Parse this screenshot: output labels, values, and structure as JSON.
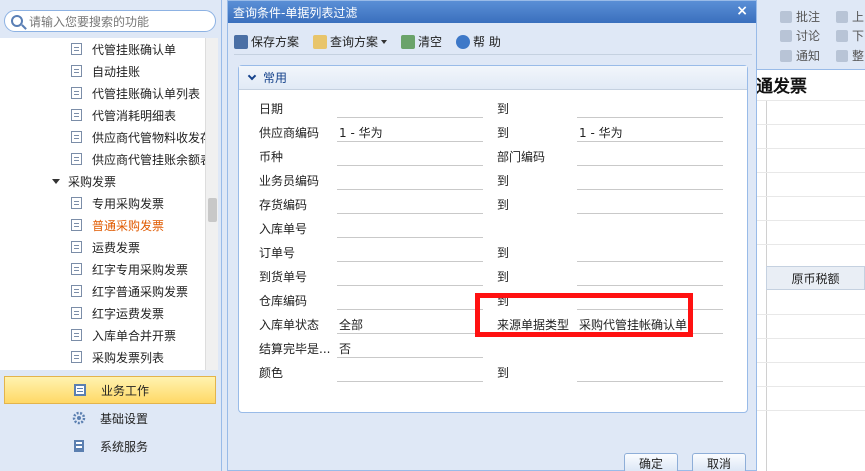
{
  "sidebar": {
    "search_placeholder": "请输入您要搜索的功能",
    "tree_items": [
      {
        "label": "代管挂账确认单",
        "indent": 2,
        "active": false
      },
      {
        "label": "自动挂账",
        "indent": 2,
        "active": false
      },
      {
        "label": "代管挂账确认单列表",
        "indent": 2,
        "active": false
      },
      {
        "label": "代管消耗明细表",
        "indent": 2,
        "active": false
      },
      {
        "label": "供应商代管物料收发存汇",
        "indent": 2,
        "active": false
      },
      {
        "label": "供应商代管挂账余额表",
        "indent": 2,
        "active": false
      },
      {
        "label": "采购发票",
        "indent": 1,
        "active": false,
        "group": true
      },
      {
        "label": "专用采购发票",
        "indent": 2,
        "active": false
      },
      {
        "label": "普通采购发票",
        "indent": 2,
        "active": true
      },
      {
        "label": "运费发票",
        "indent": 2,
        "active": false
      },
      {
        "label": "红字专用采购发票",
        "indent": 2,
        "active": false
      },
      {
        "label": "红字普通采购发票",
        "indent": 2,
        "active": false
      },
      {
        "label": "红字运费发票",
        "indent": 2,
        "active": false
      },
      {
        "label": "入库单合并开票",
        "indent": 2,
        "active": false
      },
      {
        "label": "采购发票列表",
        "indent": 2,
        "active": false
      }
    ],
    "nav": [
      {
        "label": "业务工作",
        "active": true
      },
      {
        "label": "基础设置",
        "active": false
      },
      {
        "label": "系统服务",
        "active": false
      }
    ]
  },
  "background": {
    "toolbar": {
      "approve": "批注",
      "discuss": "讨论",
      "notify": "通知",
      "up": "上",
      "down": "下",
      "whole": "整"
    },
    "title_fragment": "通发票",
    "column_header": "原币税额"
  },
  "dialog": {
    "title": "查询条件-单据列表过滤",
    "toolbar": {
      "save_scheme": "保存方案",
      "query_scheme": "查询方案",
      "clear": "清空",
      "help": "帮 助"
    },
    "section": "常用",
    "rows": [
      {
        "label": "日期",
        "value": "",
        "label2": "到",
        "value2": ""
      },
      {
        "label": "供应商编码",
        "value": "1 - 华为",
        "label2": "到",
        "value2": "1 - 华为"
      },
      {
        "label": "币种",
        "value": "",
        "label2": "部门编码",
        "value2": ""
      },
      {
        "label": "业务员编码",
        "value": "",
        "label2": "到",
        "value2": ""
      },
      {
        "label": "存货编码",
        "value": "",
        "label2": "到",
        "value2": ""
      },
      {
        "label": "入库单号",
        "value": "",
        "label2": "",
        "value2": ""
      },
      {
        "label": "订单号",
        "value": "",
        "label2": "到",
        "value2": ""
      },
      {
        "label": "到货单号",
        "value": "",
        "label2": "到",
        "value2": ""
      },
      {
        "label": "仓库编码",
        "value": "",
        "label2": "到",
        "value2": ""
      },
      {
        "label": "入库单状态",
        "value": "全部",
        "label2": "来源单据类型",
        "value2": "采购代管挂帐确认单"
      },
      {
        "label": "结算完毕是...",
        "value": "否",
        "label2": "",
        "value2": ""
      },
      {
        "label": "颜色",
        "value": "",
        "label2": "到",
        "value2": ""
      }
    ],
    "ok": "确定",
    "cancel": "取消"
  }
}
